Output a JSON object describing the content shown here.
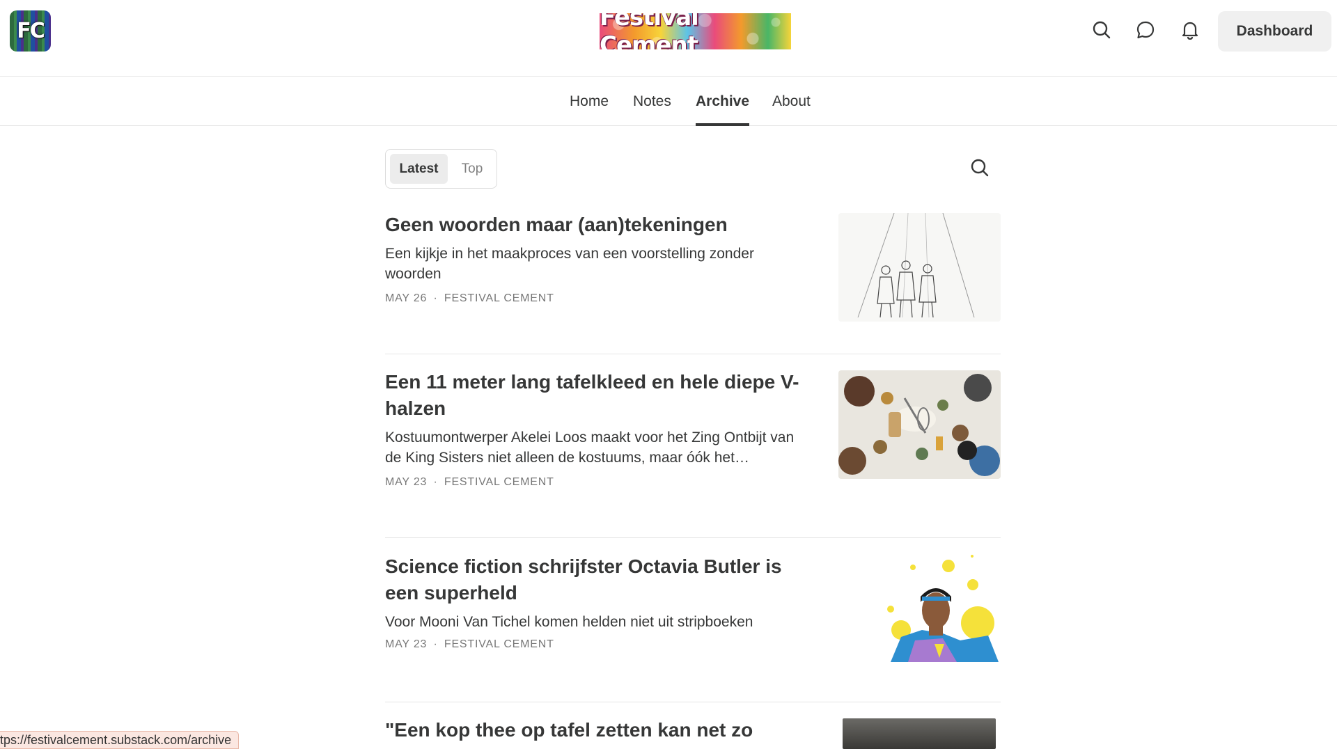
{
  "header": {
    "logo_text": "FC",
    "brand_text": "Festival Cement",
    "dashboard_label": "Dashboard",
    "icons": [
      "search-icon",
      "chat-icon",
      "bell-icon"
    ]
  },
  "nav": {
    "items": [
      {
        "label": "Home",
        "active": false
      },
      {
        "label": "Notes",
        "active": false
      },
      {
        "label": "Archive",
        "active": true
      },
      {
        "label": "About",
        "active": false
      }
    ]
  },
  "filter": {
    "latest_label": "Latest",
    "top_label": "Top",
    "selected": "Latest"
  },
  "posts": [
    {
      "title": "Geen woorden maar (aan)tekeningen",
      "subtitle": "Een kijkje in het maakproces van een voorstelling zonder woorden",
      "date": "MAY 26",
      "author": "FESTIVAL CEMENT"
    },
    {
      "title": "Een 11 meter lang tafelkleed en hele diepe V-halzen",
      "subtitle": "Kostuumontwerper Akelei Loos maakt voor het Zing Ontbijt van de King Sisters niet alleen de kostuums, maar óók het…",
      "date": "MAY 23",
      "author": "FESTIVAL CEMENT"
    },
    {
      "title": "Science fiction schrijfster Octavia Butler is een superheld",
      "subtitle": "Voor Mooni Van Tichel komen helden niet uit stripboeken",
      "date": "MAY 23",
      "author": "FESTIVAL CEMENT"
    },
    {
      "title": "\"Een kop thee op tafel zetten kan net zo",
      "subtitle": "",
      "date": "",
      "author": ""
    }
  ],
  "meta_separator": "·",
  "status_bar": {
    "url": "tps://festivalcement.substack.com/archive"
  },
  "colors": {
    "text": "#363737",
    "muted": "#777777",
    "divider": "#e6e6e6",
    "button_bg": "#f0f0f0"
  }
}
